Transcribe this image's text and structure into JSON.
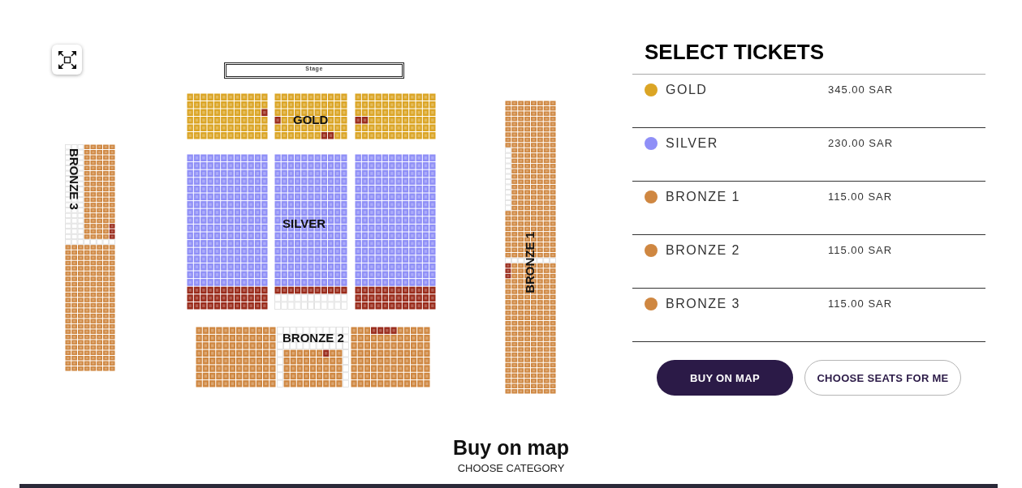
{
  "seat_map": {
    "stage": {
      "label": "Stage"
    },
    "sections": [
      {
        "label": "GOLD",
        "kind": "stalls",
        "color": "#dba525"
      },
      {
        "label": "SILVER",
        "kind": "stalls",
        "color": "#8f8ff7"
      },
      {
        "label": "BRONZE 2",
        "kind": "stalls",
        "color": "#cf8741"
      },
      {
        "label": "BRONZE 3",
        "kind": "side_left",
        "color": "#cf8741"
      },
      {
        "label": "BRONZE 1",
        "kind": "side_right",
        "color": "#cf8741"
      }
    ]
  },
  "tickets": {
    "title": "SELECT TICKETS",
    "categories": [
      {
        "name": "GOLD",
        "price": "345.00 SAR",
        "color": "#dba525"
      },
      {
        "name": "SILVER",
        "price": "230.00 SAR",
        "color": "#8f8ff7"
      },
      {
        "name": "BRONZE 1",
        "price": "115.00 SAR",
        "color": "#cf8741"
      },
      {
        "name": "BRONZE 2",
        "price": "115.00 SAR",
        "color": "#cf8741"
      },
      {
        "name": "BRONZE 3",
        "price": "115.00 SAR",
        "color": "#cf8741"
      }
    ],
    "buttons": [
      {
        "label": "BUY ON MAP",
        "kind": "primary"
      },
      {
        "label": "CHOOSE SEATS FOR ME",
        "kind": "secondary"
      }
    ]
  },
  "footer": {
    "heading": "Buy on map",
    "subheading": "CHOOSE CATEGORY"
  }
}
